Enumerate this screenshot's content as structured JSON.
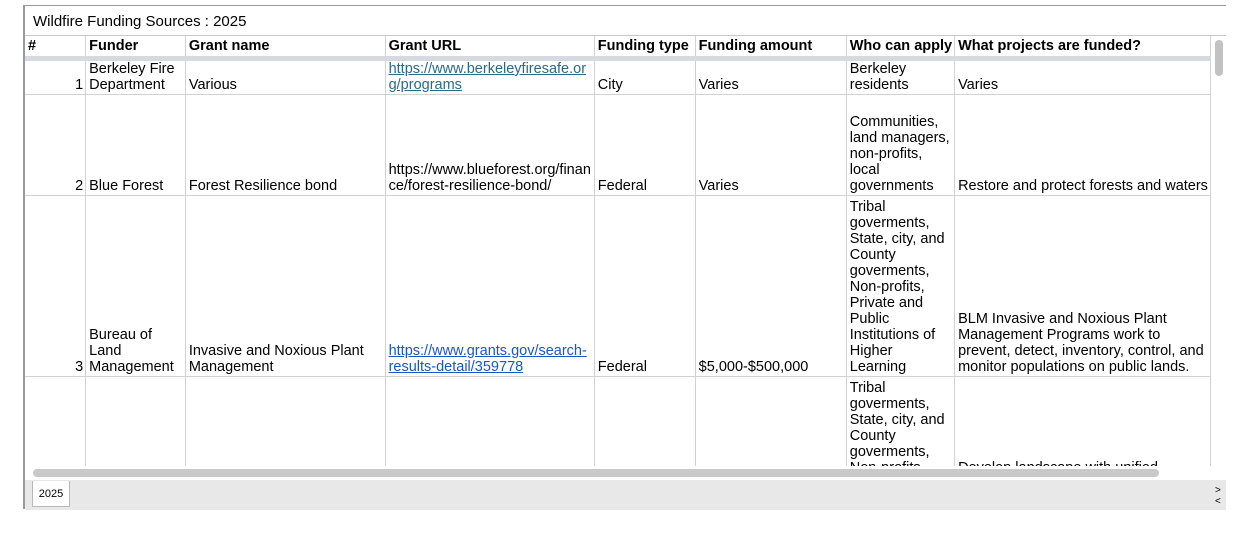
{
  "sheet": {
    "title": "Wildfire Funding Sources : 2025",
    "columns": [
      "#",
      "Funder",
      "Grant name",
      "Grant URL",
      "Funding type",
      "Funding amount",
      "Who can apply",
      "What projects are funded?"
    ],
    "rows": [
      {
        "num": "1",
        "funder": "Berkeley Fire Department",
        "grant": "Various",
        "url": "https://www.berkeleyfiresafe.org/programs",
        "url_link": true,
        "type": "City",
        "amount": "Varies",
        "who": "Berkeley residents",
        "what": "Varies"
      },
      {
        "num": "2",
        "funder": "Blue Forest",
        "grant": "Forest Resilience bond",
        "url": "https://www.blueforest.org/finance/forest-resilience-bond/",
        "url_link": false,
        "type": "Federal",
        "amount": "Varies",
        "who": "Communities, land managers, non-profits, local governments",
        "what": "Restore and protect forests and waters"
      },
      {
        "num": "3",
        "funder": "Bureau of Land Management",
        "grant": "Invasive and Noxious Plant Management",
        "url": "https://www.grants.gov/search-results-detail/359778",
        "url_link": true,
        "type": "Federal",
        "amount": "$5,000-$500,000",
        "who": "Tribal goverments, State, city, and County goverments, Non-profits, Private and Public Institutions of Higher Learning",
        "what": "BLM Invasive and Noxious Plant Management Programs work to prevent, detect, inventory, control, and monitor populations on public lands."
      },
      {
        "num": "",
        "funder": "",
        "grant": "",
        "url": "",
        "url_link": false,
        "type": "",
        "amount": "",
        "who": "Tribal goverments, State, city, and County goverments, Non-profits",
        "what": "Develop landscape with unified"
      }
    ]
  },
  "tabs": [
    "2025"
  ],
  "scroll_arrows": {
    "right": ">",
    "left": "<"
  },
  "colors": {
    "link": "#1a56c4",
    "visited_link": "#2b6a86",
    "header_rule": "#d6d9df",
    "tab_bar": "#e8e8e8"
  }
}
